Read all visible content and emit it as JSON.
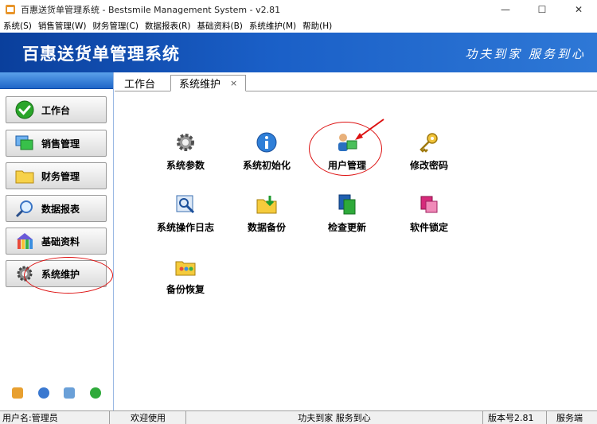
{
  "window": {
    "title": "百惠送货单管理系统 - Bestsmile Management System - v2.81",
    "minimize": "—",
    "maximize": "☐",
    "close": "✕"
  },
  "menu": [
    {
      "label": "系统(S)"
    },
    {
      "label": "销售管理(W)"
    },
    {
      "label": "财务管理(C)"
    },
    {
      "label": "数据报表(R)"
    },
    {
      "label": "基础资料(B)"
    },
    {
      "label": "系统维护(M)"
    },
    {
      "label": "帮助(H)"
    }
  ],
  "banner": {
    "title": "百惠送货单管理系统",
    "slogan": "功夫到家 服务到心"
  },
  "sidebar": {
    "items": [
      {
        "label": "工作台",
        "icon": "check-icon"
      },
      {
        "label": "销售管理",
        "icon": "windows-icon"
      },
      {
        "label": "财务管理",
        "icon": "folder-icon"
      },
      {
        "label": "数据报表",
        "icon": "magnifier-icon"
      },
      {
        "label": "基础资料",
        "icon": "house-icon"
      },
      {
        "label": "系统维护",
        "icon": "gear-icon"
      }
    ]
  },
  "tabs": [
    {
      "label": "工作台",
      "active": false
    },
    {
      "label": "系统维护",
      "active": true,
      "close": "×"
    }
  ],
  "tiles": [
    {
      "label": "系统参数",
      "icon": "gear-icon"
    },
    {
      "label": "系统初始化",
      "icon": "info-icon"
    },
    {
      "label": "用户管理",
      "icon": "users-icon"
    },
    {
      "label": "修改密码",
      "icon": "key-icon"
    },
    {
      "label": "系统操作日志",
      "icon": "log-icon"
    },
    {
      "label": "数据备份",
      "icon": "backup-icon"
    },
    {
      "label": "检查更新",
      "icon": "update-icon"
    },
    {
      "label": "软件锁定",
      "icon": "lock-icon"
    },
    {
      "label": "备份恢复",
      "icon": "restore-icon"
    }
  ],
  "status": {
    "user": "用户名:管理员",
    "welcome": "欢迎使用",
    "slogan": "功夫到家 服务到心",
    "version": "版本号2.81",
    "mode": "服务端"
  },
  "colors": {
    "banner": "#1a5fc7",
    "annotation": "#dd1111"
  }
}
